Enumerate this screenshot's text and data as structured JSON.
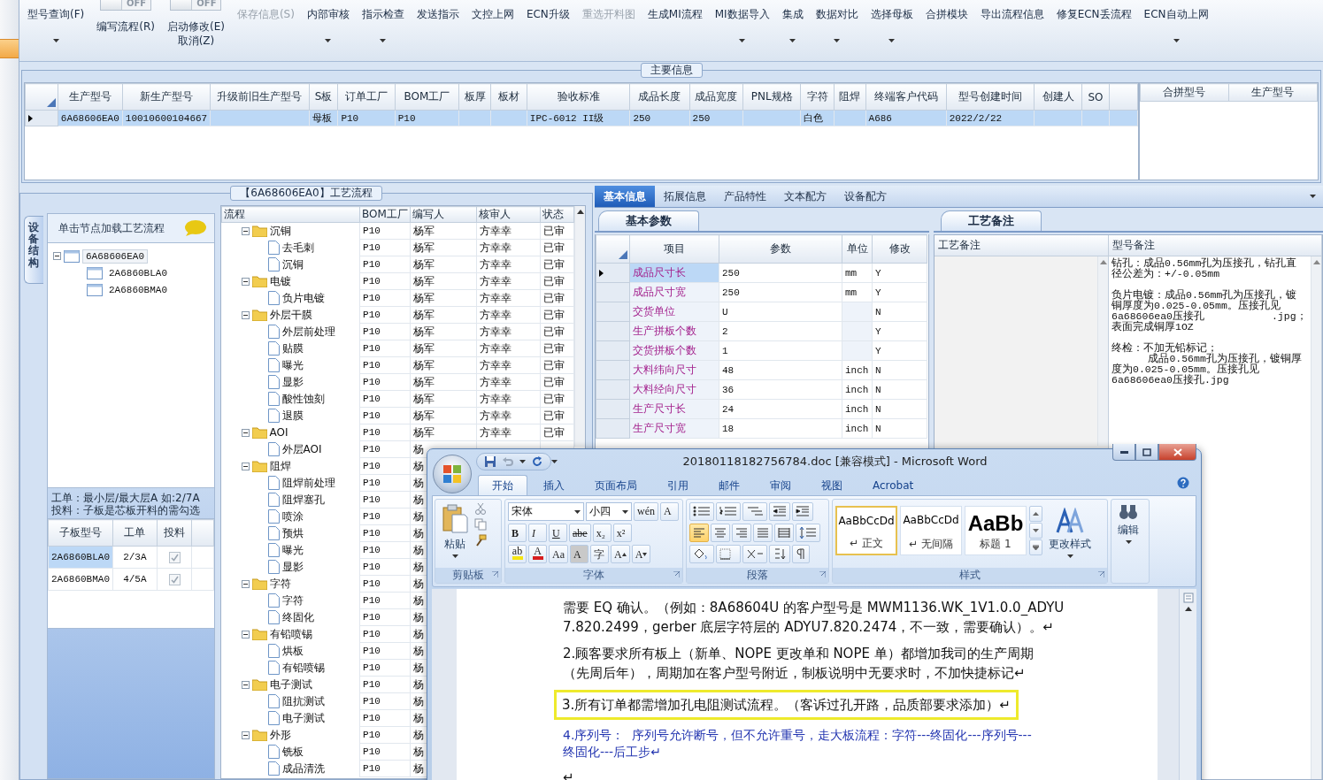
{
  "toolbar": {
    "items": [
      {
        "label": "型号查询(F)",
        "dropdown": true,
        "disabled": false
      },
      {
        "label": "编写流程(R)",
        "dropdown": false,
        "disabled": false,
        "switch": {
          "on": false,
          "text": "OFF"
        }
      },
      {
        "label": "启动修改(E)",
        "sublabel": "取消(Z)",
        "dropdown": false,
        "disabled": false,
        "switch": {
          "on": false,
          "text": "OFF"
        }
      },
      {
        "label": "保存信息(S)",
        "dropdown": false,
        "disabled": true
      },
      {
        "label": "内部审核",
        "dropdown": true,
        "disabled": false
      },
      {
        "label": "指示检查",
        "dropdown": true,
        "disabled": false
      },
      {
        "label": "发送指示",
        "dropdown": false,
        "disabled": false
      },
      {
        "label": "文控上网",
        "dropdown": false,
        "disabled": false
      },
      {
        "label": "ECN升级",
        "dropdown": false,
        "disabled": false
      },
      {
        "label": "重选开料图",
        "dropdown": false,
        "disabled": true
      },
      {
        "label": "生成MI流程",
        "dropdown": false,
        "disabled": false
      },
      {
        "label": "MI数据导入",
        "dropdown": true,
        "disabled": false
      },
      {
        "label": "集成",
        "dropdown": true,
        "disabled": false
      },
      {
        "label": "数据对比",
        "dropdown": true,
        "disabled": false
      },
      {
        "label": "选择母板",
        "dropdown": true,
        "disabled": false
      },
      {
        "label": "合拼模块",
        "dropdown": false,
        "disabled": false
      },
      {
        "label": "导出流程信息",
        "dropdown": false,
        "disabled": false
      },
      {
        "label": "修复ECN丢流程",
        "dropdown": false,
        "disabled": false
      },
      {
        "label": "ECN自动上网",
        "dropdown": true,
        "disabled": false
      }
    ]
  },
  "main_info": {
    "legend": "主要信息",
    "columns": [
      "生产型号",
      "新生产型号",
      "升级前旧生产型号",
      "S板",
      "订单工厂",
      "BOM工厂",
      "板厚",
      "板材",
      "验收标准",
      "成品长度",
      "成品宽度",
      "PNL规格",
      "字符",
      "阻焊",
      "终端客户代码",
      "型号创建时间",
      "创建人",
      "SO"
    ],
    "rows": [
      {
        "selected": true,
        "cells": [
          "6A68606EA0",
          "10010600104667",
          null,
          "母板",
          "P10",
          "P10",
          null,
          null,
          "IPC-6012 II级",
          "250",
          "250",
          null,
          "白色",
          null,
          "A686",
          "2022/2/22",
          null,
          null
        ]
      }
    ],
    "side_columns": [
      "合拼型号",
      "生产型号"
    ]
  },
  "process": {
    "legend": "【6A68606EA0】工艺流程",
    "side_tab": "设备结构",
    "hint": "单击节点加载工艺流程",
    "tree": [
      {
        "label": "6A68606EA0",
        "expanded": true,
        "selected": true,
        "children": [
          {
            "label": "2A6860BLA0",
            "selected": false
          },
          {
            "label": "2A6860BMA0",
            "selected": false
          }
        ]
      }
    ],
    "note": "工单：最小层/最大层A 如:2/7A\n投料：子板是芯板开料的需勾选",
    "sub_grid": {
      "columns": [
        "子板型号",
        "工单",
        "投料"
      ],
      "rows": [
        {
          "cells": [
            "2A6860BLA0",
            "2/3A"
          ],
          "checked": true,
          "selected": true
        },
        {
          "cells": [
            "2A6860BMA0",
            "4/5A"
          ],
          "checked": true,
          "selected": false
        }
      ]
    },
    "flow_grid": {
      "columns": [
        "流程",
        "BOM工厂",
        "编写人",
        "核审人",
        "状态"
      ],
      "rows": [
        {
          "name": "沉铜",
          "bom": "P10",
          "writer": "杨军",
          "checker": "方幸幸",
          "status": "已审",
          "expanded": true,
          "children": [
            {
              "name": "去毛刺",
              "bom": "P10",
              "writer": "杨军",
              "checker": "方幸幸",
              "status": "已审"
            },
            {
              "name": "沉铜",
              "bom": "P10",
              "writer": "杨军",
              "checker": "方幸幸",
              "status": "已审"
            }
          ]
        },
        {
          "name": "电镀",
          "bom": "P10",
          "writer": "杨军",
          "checker": "方幸幸",
          "status": "已审",
          "expanded": true,
          "children": [
            {
              "name": "负片电镀",
              "bom": "P10",
              "writer": "杨军",
              "checker": "方幸幸",
              "status": "已审"
            }
          ]
        },
        {
          "name": "外层干膜",
          "bom": "P10",
          "writer": "杨军",
          "checker": "方幸幸",
          "status": "已审",
          "expanded": true,
          "children": [
            {
              "name": "外层前处理",
              "bom": "P10",
              "writer": "杨军",
              "checker": "方幸幸",
              "status": "已审"
            },
            {
              "name": "贴膜",
              "bom": "P10",
              "writer": "杨军",
              "checker": "方幸幸",
              "status": "已审"
            },
            {
              "name": "曝光",
              "bom": "P10",
              "writer": "杨军",
              "checker": "方幸幸",
              "status": "已审"
            },
            {
              "name": "显影",
              "bom": "P10",
              "writer": "杨军",
              "checker": "方幸幸",
              "status": "已审"
            },
            {
              "name": "酸性蚀刻",
              "bom": "P10",
              "writer": "杨军",
              "checker": "方幸幸",
              "status": "已审"
            },
            {
              "name": "退膜",
              "bom": "P10",
              "writer": "杨军",
              "checker": "方幸幸",
              "status": "已审"
            }
          ]
        },
        {
          "name": "AOI",
          "bom": "P10",
          "writer": "杨军",
          "checker": "方幸幸",
          "status": "已审",
          "expanded": true,
          "children": [
            {
              "name": "外层AOI",
              "bom": "P10",
              "writer": "杨"
            }
          ]
        },
        {
          "name": "阻焊",
          "bom": "P10",
          "writer": "杨",
          "expanded": true,
          "children": [
            {
              "name": "阻焊前处理",
              "bom": "P10",
              "writer": "杨"
            },
            {
              "name": "阻焊塞孔",
              "bom": "P10",
              "writer": "杨"
            },
            {
              "name": "喷涂",
              "bom": "P10",
              "writer": "杨"
            },
            {
              "name": "预烘",
              "bom": "P10",
              "writer": "杨"
            },
            {
              "name": "曝光",
              "bom": "P10",
              "writer": "杨"
            },
            {
              "name": "显影",
              "bom": "P10",
              "writer": "杨"
            }
          ]
        },
        {
          "name": "字符",
          "bom": "P10",
          "writer": "杨",
          "expanded": true,
          "children": [
            {
              "name": "字符",
              "bom": "P10",
              "writer": "杨"
            },
            {
              "name": "终固化",
              "bom": "P10",
              "writer": "杨"
            }
          ]
        },
        {
          "name": "有铅喷锡",
          "bom": "P10",
          "writer": "杨",
          "expanded": true,
          "children": [
            {
              "name": "烘板",
              "bom": "P10",
              "writer": "杨"
            },
            {
              "name": "有铅喷锡",
              "bom": "P10",
              "writer": "杨"
            }
          ]
        },
        {
          "name": "电子测试",
          "bom": "P10",
          "writer": "杨",
          "expanded": true,
          "children": [
            {
              "name": "阻抗测试",
              "bom": "P10",
              "writer": "杨"
            },
            {
              "name": "电子测试",
              "bom": "P10",
              "writer": "杨"
            }
          ]
        },
        {
          "name": "外形",
          "bom": "P10",
          "writer": "杨",
          "expanded": true,
          "children": [
            {
              "name": "铣板",
              "bom": "P10",
              "writer": "杨"
            },
            {
              "name": "成品清洗",
              "bom": "P10",
              "writer": "杨"
            }
          ]
        }
      ]
    }
  },
  "detail": {
    "tabs": [
      {
        "label": "基本信息",
        "selected": true
      },
      {
        "label": "拓展信息",
        "selected": false
      },
      {
        "label": "产品特性",
        "selected": false
      },
      {
        "label": "文本配方",
        "selected": false
      },
      {
        "label": "设备配方",
        "selected": false
      }
    ],
    "params": {
      "tab": "基本参数",
      "columns": [
        "项目",
        "参数",
        "单位",
        "修改"
      ],
      "rows": [
        {
          "item": "成品尺寸长",
          "value": "250",
          "unit": "mm",
          "modify": "Y",
          "selected": true
        },
        {
          "item": "成品尺寸宽",
          "value": "250",
          "unit": "mm",
          "modify": "Y",
          "selected": false
        },
        {
          "item": "交货单位",
          "value": "U",
          "modify": "N",
          "selected": false
        },
        {
          "item": "生产拼板个数",
          "value": "2",
          "modify": "Y",
          "selected": false
        },
        {
          "item": "交货拼板个数",
          "value": "1",
          "modify": "Y",
          "selected": false
        },
        {
          "item": "大料纬向尺寸",
          "value": "48",
          "unit": "inch",
          "modify": "N",
          "selected": false
        },
        {
          "item": "大料经向尺寸",
          "value": "36",
          "unit": "inch",
          "modify": "N",
          "selected": false
        },
        {
          "item": "生产尺寸长",
          "value": "24",
          "unit": "inch",
          "modify": "N",
          "selected": false
        },
        {
          "item": "生产尺寸宽",
          "value": "18",
          "unit": "inch",
          "modify": "N",
          "selected": false
        }
      ]
    },
    "notes": {
      "tab": "工艺备注",
      "columns": [
        "工艺备注",
        "型号备注"
      ],
      "model_note": [
        [
          "钻孔：成品0.56mm孔为压接孔，钻孔直",
          "径公差为：+/-0.05mm"
        ],
        [
          "负片电镀：成品0.56mm孔为压接孔，镀",
          "铜厚度为0.025-0.05mm。压接孔见",
          "6a68606ea0压接孔           .jpg；",
          "表面完成铜厚1OZ"
        ],
        [
          "终检：不加无铅标记；",
          "      成品0.56mm孔为压接孔，镀铜厚",
          "度为0.025-0.05mm。压接孔见",
          "6a68606ea0压接孔.jpg"
        ]
      ]
    }
  },
  "word": {
    "title": "20180118182756784.doc [兼容模式] - Microsoft Word",
    "tabs": [
      {
        "label": "开始",
        "selected": true
      },
      {
        "label": "插入",
        "selected": false
      },
      {
        "label": "页面布局",
        "selected": false
      },
      {
        "label": "引用",
        "selected": false
      },
      {
        "label": "邮件",
        "selected": false
      },
      {
        "label": "审阅",
        "selected": false
      },
      {
        "label": "视图",
        "selected": false
      },
      {
        "label": "Acrobat",
        "selected": false
      }
    ],
    "paste": "粘贴",
    "font_name": "宋体",
    "font_size": "小四",
    "font_buttons": [
      [
        {
          "label": "wén",
          "kind": "phonetic"
        },
        {
          "label": "A",
          "kind": "border"
        }
      ],
      [
        {
          "label": "B",
          "kind": "bold"
        },
        {
          "label": "I",
          "kind": "italic"
        },
        {
          "label": "U",
          "kind": "underline"
        },
        {
          "label": "abe",
          "kind": "strike"
        },
        {
          "label": "x₂",
          "kind": "sub"
        },
        {
          "label": "x²",
          "kind": "super"
        }
      ],
      [
        {
          "label": "ab",
          "kind": "highlight"
        },
        {
          "label": "A",
          "kind": "color"
        },
        {
          "label": "Aa",
          "kind": "case"
        },
        {
          "label": "A",
          "kind": "shade"
        },
        {
          "label": "字",
          "kind": "enclose"
        },
        {
          "label": "A",
          "kind": "grow"
        },
        {
          "label": "A",
          "kind": "shrink"
        }
      ]
    ],
    "align_buttons": [
      {
        "kind": "left",
        "selected": true
      },
      {
        "kind": "center",
        "selected": false
      },
      {
        "kind": "right",
        "selected": false
      },
      {
        "kind": "justify",
        "selected": false
      },
      {
        "kind": "distributed",
        "selected": false
      }
    ],
    "styles": [
      {
        "sample": "AaBbCcDd",
        "name": "↵ 正文",
        "kind": "normal",
        "selected": true
      },
      {
        "sample": "AaBbCcDd",
        "name": "↵ 无间隔",
        "kind": "normal",
        "selected": false
      },
      {
        "sample": "AaBb",
        "name": "标题 1",
        "kind": "heading",
        "selected": false
      }
    ],
    "change_styles": "更改样式",
    "edit": "编辑",
    "groups": [
      "剪贴板",
      "字体",
      "段落",
      "样式"
    ],
    "paragraphs": [
      {
        "kind": "normal",
        "lines": [
          "需要 EQ 确认。（例如：8A68604U 的客户型号是 MWM1136.WK_1V1.0.0_ADYU",
          "7.820.2499，gerber 底层字符层的 ADYU7.820.2474，不一致，需要确认）。↵"
        ]
      },
      {
        "kind": "normal",
        "lines": [
          "2.顾客要求所有板上（新单、NOPE 更改单和 NOPE 单）都增加我司的生产周期",
          "（先周后年），周期加在客户型号附近，制板说明中无要求时，不加快捷标记↵"
        ]
      },
      {
        "kind": "boxed",
        "lines": [
          "3.所有订单都需增加孔电阻测试流程。（客诉过孔开路，品质部要求添加）↵"
        ]
      },
      {
        "kind": "blue",
        "lines": [
          "4.序列号：  序列号允许断号，但不允许重号，走大板流程：字符---终固化---序列号---",
          "终固化---后工步↵"
        ]
      },
      {
        "kind": "normal",
        "lines": [
          "↵"
        ]
      }
    ]
  }
}
